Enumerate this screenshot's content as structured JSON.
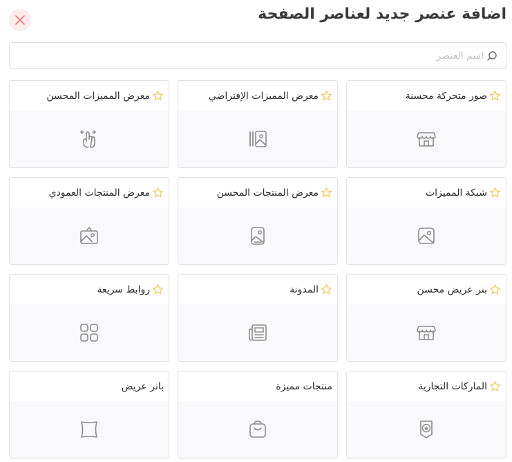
{
  "header": {
    "title": "اضافة عنصر جديد لعناصر الصفحة",
    "close_icon": "close-icon"
  },
  "search": {
    "placeholder": "اسم العنصر",
    "value": "",
    "icon": "search-icon"
  },
  "colors": {
    "star": "#f2c94c",
    "close": "#e57373",
    "close_bg": "#fdeceb",
    "icon": "#8a8a8a"
  },
  "items": [
    {
      "label": "صور متحركة محسنة",
      "icon": "store-icon",
      "starred": true
    },
    {
      "label": "معرض المميزات الإفتراضي",
      "icon": "image-gallery-icon",
      "starred": true
    },
    {
      "label": "معرض المميزات المحسن",
      "icon": "hand-swipe-icon",
      "starred": true
    },
    {
      "label": "شبكة المميزات",
      "icon": "image-square-icon",
      "starred": true
    },
    {
      "label": "معرض المنتجات المحسن",
      "icon": "image-portrait-icon",
      "starred": true
    },
    {
      "label": "معرض المنتجات العمودي",
      "icon": "image-landscape-icon",
      "starred": true
    },
    {
      "label": "بنر عريض محسن",
      "icon": "store-icon",
      "starred": true
    },
    {
      "label": "المدونة",
      "icon": "newspaper-icon",
      "starred": true
    },
    {
      "label": "روابط سريعة",
      "icon": "grid-icon",
      "starred": true
    },
    {
      "label": "الماركات التجارية",
      "icon": "award-badge-icon",
      "starred": true
    },
    {
      "label": "منتجات مميزة",
      "icon": "shopping-bag-icon",
      "starred": false
    },
    {
      "label": "بانر عريض",
      "icon": "banner-icon",
      "starred": false
    }
  ]
}
